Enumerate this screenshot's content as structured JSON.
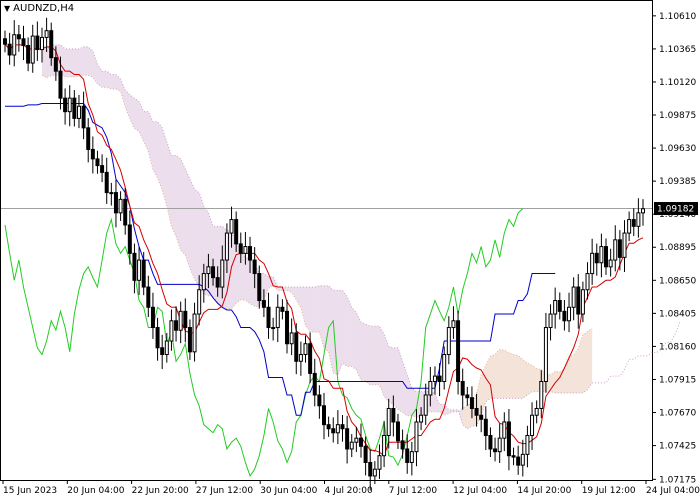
{
  "chart": {
    "symbol": "AUDNZD,H4",
    "current_price_label": "1.09182",
    "colors": {
      "background": "#ffffff",
      "candle": "#000000",
      "tenkan": "#d40000",
      "kijun": "#0000c8",
      "chikou": "#22cc22",
      "cloud_bull": "#e0b090",
      "cloud_bear": "#c8a0c8",
      "price_line": "#a0a0a0",
      "price_tag_bg": "#000000",
      "price_tag_text": "#ffffff"
    }
  },
  "chart_data": {
    "type": "candlestick",
    "title": "AUDNZD,H4",
    "y_axis_ticks": [
      "1.10610",
      "1.10365",
      "1.10120",
      "1.09875",
      "1.09630",
      "1.09385",
      "1.09140",
      "1.08895",
      "1.08650",
      "1.08405",
      "1.08160",
      "1.07915",
      "1.07670",
      "1.07425",
      "1.07175"
    ],
    "ylim": [
      1.0717,
      1.1072
    ],
    "x_axis_ticks": [
      "15 Jun 2023",
      "20 Jun 04:00",
      "22 Jun 20:00",
      "27 Jun 12:00",
      "30 Jun 04:00",
      "4 Jul 20:00",
      "7 Jul 12:00",
      "12 Jul 04:00",
      "14 Jul 20:00",
      "19 Jul 12:00",
      "24 Jul 04:00"
    ],
    "last_price": 1.09182,
    "indicators": [
      "Tenkan-sen",
      "Kijun-sen",
      "Chikou Span",
      "Senkou Span A",
      "Senkou Span B"
    ],
    "close_series": [
      1.104,
      1.1032,
      1.1047,
      1.1044,
      1.1039,
      1.1026,
      1.1046,
      1.1036,
      1.1045,
      1.105,
      1.103,
      1.102,
      1.1,
      1.099,
      1.1,
      1.0985,
      1.0994,
      1.0978,
      1.0962,
      1.0955,
      1.095,
      1.0945,
      1.093,
      1.093,
      1.0915,
      1.0925,
      1.0906,
      1.0885,
      1.0865,
      1.088,
      1.086,
      1.0845,
      1.083,
      1.0815,
      1.081,
      1.082,
      1.0835,
      1.0828,
      1.0842,
      1.083,
      1.0812,
      1.084,
      1.0858,
      1.087,
      1.0875,
      1.0867,
      1.086,
      1.088,
      1.09,
      1.091,
      1.0892,
      1.0885,
      1.089,
      1.088,
      1.087,
      1.085,
      1.0845,
      1.083,
      1.083,
      1.0845,
      1.0842,
      1.0818,
      1.0826,
      1.0805,
      1.081,
      1.0818,
      1.0796,
      1.078,
      1.0772,
      1.0758,
      1.0755,
      1.0752,
      1.0758,
      1.0755,
      1.074,
      1.0745,
      1.0748,
      1.0742,
      1.073,
      1.072,
      1.0725,
      1.0735,
      1.075,
      1.077,
      1.076,
      1.0746,
      1.074,
      1.073,
      1.0738,
      1.076,
      1.0765,
      1.078,
      1.079,
      1.0794,
      1.079,
      1.081,
      1.083,
      1.0835,
      1.079,
      1.078,
      1.0778,
      1.077,
      1.0765,
      1.0762,
      1.075,
      1.074,
      1.0738,
      1.0748,
      1.076,
      1.0735,
      1.0734,
      1.0728,
      1.0736,
      1.075,
      1.0765,
      1.077,
      1.079,
      1.083,
      1.084,
      1.085,
      1.0842,
      1.0835,
      1.0845,
      1.086,
      1.084,
      1.0858,
      1.087,
      1.0885,
      1.0878,
      1.089,
      1.0875,
      1.088,
      1.0895,
      1.0882,
      1.09,
      1.091,
      1.0905,
      1.0915,
      1.0918
    ],
    "kijun_series": [
      1.0994,
      1.0994,
      1.0994,
      1.0994,
      1.0994,
      1.0995,
      1.0995,
      1.0995,
      1.0996,
      1.0996,
      1.0996,
      1.0996,
      1.0996,
      1.0996,
      1.0996,
      1.0996,
      1.0996,
      1.0996,
      1.0991,
      1.0982,
      1.098,
      1.0978,
      1.0971,
      1.0959,
      1.094,
      1.0935,
      1.093,
      1.092,
      1.0903,
      1.089,
      1.088,
      1.088,
      1.087,
      1.0862,
      1.0862,
      1.0862,
      1.0862,
      1.0862,
      1.0862,
      1.0862,
      1.0862,
      1.0862,
      1.0862,
      1.086,
      1.0857,
      1.0852,
      1.0848,
      1.0845,
      1.0843,
      1.0843,
      1.0838,
      1.083,
      1.083,
      1.083,
      1.0827,
      1.0821,
      1.0812,
      1.0793,
      1.0793,
      1.0793,
      1.0793,
      1.078,
      1.078,
      1.0765,
      1.0765,
      1.0782,
      1.0782,
      1.079,
      1.079,
      1.079,
      1.079,
      1.079,
      1.079,
      1.079,
      1.079,
      1.079,
      1.079,
      1.079,
      1.079,
      1.079,
      1.079,
      1.079,
      1.079,
      1.079,
      1.079,
      1.079,
      1.079,
      1.0785,
      1.0785,
      1.0785,
      1.0785,
      1.0785,
      1.0785,
      1.0785,
      1.08,
      1.082,
      1.082,
      1.082,
      1.082,
      1.082,
      1.082,
      1.082,
      1.082,
      1.082,
      1.082,
      1.082,
      1.084,
      1.084,
      1.084,
      1.084,
      1.084,
      1.085,
      1.085,
      1.0855,
      1.087,
      1.087,
      1.087,
      1.087,
      1.087,
      1.087
    ]
  }
}
